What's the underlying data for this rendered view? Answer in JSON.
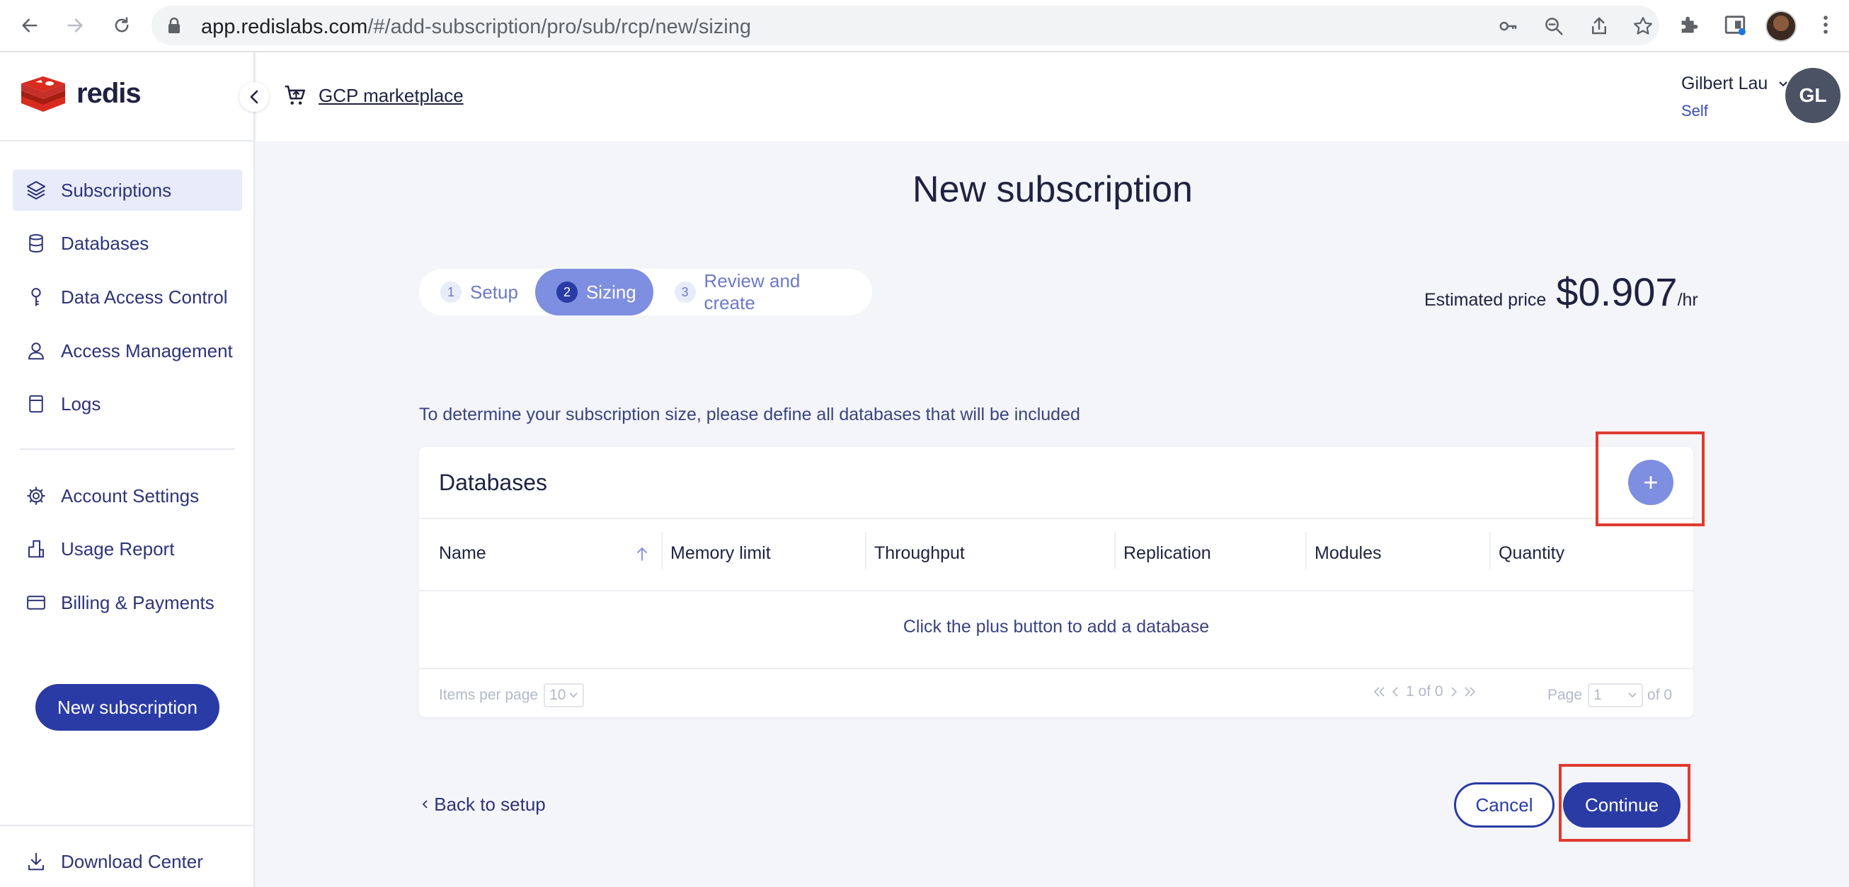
{
  "browser": {
    "url_host": "app.redislabs.com",
    "url_path": "/#/add-subscription/pro/sub/rcp/new/sizing"
  },
  "sidebar": {
    "logo_text": "redis",
    "items": [
      {
        "label": "Subscriptions",
        "icon": "layers-icon"
      },
      {
        "label": "Databases",
        "icon": "database-icon"
      },
      {
        "label": "Data Access Control",
        "icon": "key-icon"
      },
      {
        "label": "Access Management",
        "icon": "person-icon"
      },
      {
        "label": "Logs",
        "icon": "document-icon"
      },
      {
        "label": "Account Settings",
        "icon": "gear-icon"
      },
      {
        "label": "Usage Report",
        "icon": "report-icon"
      },
      {
        "label": "Billing & Payments",
        "icon": "card-icon"
      }
    ],
    "new_subscription_label": "New subscription",
    "download_center_label": "Download Center"
  },
  "header": {
    "marketplace_label": "GCP marketplace",
    "user_name": "Gilbert Lau",
    "user_role": "Self",
    "avatar_initials": "GL"
  },
  "main": {
    "title": "New subscription",
    "steps": [
      {
        "num": "1",
        "label": "Setup"
      },
      {
        "num": "2",
        "label": "Sizing"
      },
      {
        "num": "3",
        "label": "Review and create"
      }
    ],
    "estimated_price_label": "Estimated price",
    "estimated_price_value": "$0.907",
    "estimated_price_unit": "/hr",
    "subtitle": "To determine your subscription size, please define all databases that will be included",
    "databases_card": {
      "title": "Databases",
      "add_symbol": "+",
      "columns": [
        "Name",
        "Memory limit",
        "Throughput",
        "Replication",
        "Modules",
        "Quantity"
      ],
      "empty_message": "Click the plus button to add a database",
      "items_per_page_label": "Items per page",
      "items_per_page_value": "10",
      "range_text": "1 of 0",
      "page_label": "Page",
      "page_value": "1",
      "page_total": "of 0"
    },
    "back_label": "Back to setup",
    "cancel_label": "Cancel",
    "continue_label": "Continue"
  },
  "colors": {
    "brand_primary": "#2a3ba5",
    "brand_light": "#7e8ee0",
    "redis_red": "#d82c20",
    "highlight_red": "#e03a2f"
  }
}
